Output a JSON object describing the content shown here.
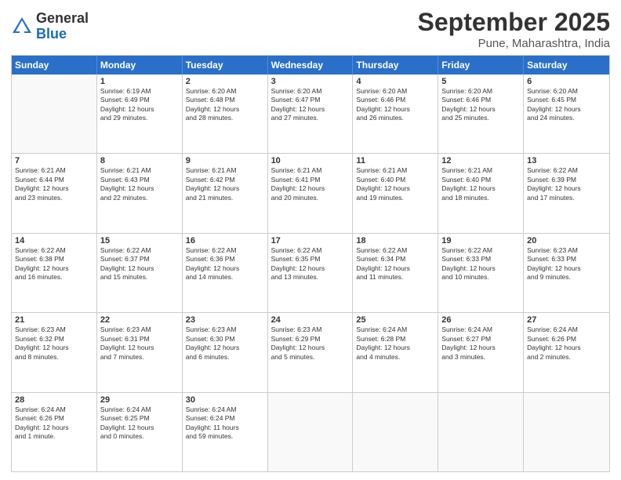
{
  "logo": {
    "general": "General",
    "blue": "Blue"
  },
  "title": "September 2025",
  "subtitle": "Pune, Maharashtra, India",
  "days": [
    "Sunday",
    "Monday",
    "Tuesday",
    "Wednesday",
    "Thursday",
    "Friday",
    "Saturday"
  ],
  "weeks": [
    [
      {
        "day": "",
        "info": ""
      },
      {
        "day": "1",
        "info": "Sunrise: 6:19 AM\nSunset: 6:49 PM\nDaylight: 12 hours\nand 29 minutes."
      },
      {
        "day": "2",
        "info": "Sunrise: 6:20 AM\nSunset: 6:48 PM\nDaylight: 12 hours\nand 28 minutes."
      },
      {
        "day": "3",
        "info": "Sunrise: 6:20 AM\nSunset: 6:47 PM\nDaylight: 12 hours\nand 27 minutes."
      },
      {
        "day": "4",
        "info": "Sunrise: 6:20 AM\nSunset: 6:46 PM\nDaylight: 12 hours\nand 26 minutes."
      },
      {
        "day": "5",
        "info": "Sunrise: 6:20 AM\nSunset: 6:46 PM\nDaylight: 12 hours\nand 25 minutes."
      },
      {
        "day": "6",
        "info": "Sunrise: 6:20 AM\nSunset: 6:45 PM\nDaylight: 12 hours\nand 24 minutes."
      }
    ],
    [
      {
        "day": "7",
        "info": "Sunrise: 6:21 AM\nSunset: 6:44 PM\nDaylight: 12 hours\nand 23 minutes."
      },
      {
        "day": "8",
        "info": "Sunrise: 6:21 AM\nSunset: 6:43 PM\nDaylight: 12 hours\nand 22 minutes."
      },
      {
        "day": "9",
        "info": "Sunrise: 6:21 AM\nSunset: 6:42 PM\nDaylight: 12 hours\nand 21 minutes."
      },
      {
        "day": "10",
        "info": "Sunrise: 6:21 AM\nSunset: 6:41 PM\nDaylight: 12 hours\nand 20 minutes."
      },
      {
        "day": "11",
        "info": "Sunrise: 6:21 AM\nSunset: 6:40 PM\nDaylight: 12 hours\nand 19 minutes."
      },
      {
        "day": "12",
        "info": "Sunrise: 6:21 AM\nSunset: 6:40 PM\nDaylight: 12 hours\nand 18 minutes."
      },
      {
        "day": "13",
        "info": "Sunrise: 6:22 AM\nSunset: 6:39 PM\nDaylight: 12 hours\nand 17 minutes."
      }
    ],
    [
      {
        "day": "14",
        "info": "Sunrise: 6:22 AM\nSunset: 6:38 PM\nDaylight: 12 hours\nand 16 minutes."
      },
      {
        "day": "15",
        "info": "Sunrise: 6:22 AM\nSunset: 6:37 PM\nDaylight: 12 hours\nand 15 minutes."
      },
      {
        "day": "16",
        "info": "Sunrise: 6:22 AM\nSunset: 6:36 PM\nDaylight: 12 hours\nand 14 minutes."
      },
      {
        "day": "17",
        "info": "Sunrise: 6:22 AM\nSunset: 6:35 PM\nDaylight: 12 hours\nand 13 minutes."
      },
      {
        "day": "18",
        "info": "Sunrise: 6:22 AM\nSunset: 6:34 PM\nDaylight: 12 hours\nand 11 minutes."
      },
      {
        "day": "19",
        "info": "Sunrise: 6:22 AM\nSunset: 6:33 PM\nDaylight: 12 hours\nand 10 minutes."
      },
      {
        "day": "20",
        "info": "Sunrise: 6:23 AM\nSunset: 6:33 PM\nDaylight: 12 hours\nand 9 minutes."
      }
    ],
    [
      {
        "day": "21",
        "info": "Sunrise: 6:23 AM\nSunset: 6:32 PM\nDaylight: 12 hours\nand 8 minutes."
      },
      {
        "day": "22",
        "info": "Sunrise: 6:23 AM\nSunset: 6:31 PM\nDaylight: 12 hours\nand 7 minutes."
      },
      {
        "day": "23",
        "info": "Sunrise: 6:23 AM\nSunset: 6:30 PM\nDaylight: 12 hours\nand 6 minutes."
      },
      {
        "day": "24",
        "info": "Sunrise: 6:23 AM\nSunset: 6:29 PM\nDaylight: 12 hours\nand 5 minutes."
      },
      {
        "day": "25",
        "info": "Sunrise: 6:24 AM\nSunset: 6:28 PM\nDaylight: 12 hours\nand 4 minutes."
      },
      {
        "day": "26",
        "info": "Sunrise: 6:24 AM\nSunset: 6:27 PM\nDaylight: 12 hours\nand 3 minutes."
      },
      {
        "day": "27",
        "info": "Sunrise: 6:24 AM\nSunset: 6:26 PM\nDaylight: 12 hours\nand 2 minutes."
      }
    ],
    [
      {
        "day": "28",
        "info": "Sunrise: 6:24 AM\nSunset: 6:26 PM\nDaylight: 12 hours\nand 1 minute."
      },
      {
        "day": "29",
        "info": "Sunrise: 6:24 AM\nSunset: 6:25 PM\nDaylight: 12 hours\nand 0 minutes."
      },
      {
        "day": "30",
        "info": "Sunrise: 6:24 AM\nSunset: 6:24 PM\nDaylight: 11 hours\nand 59 minutes."
      },
      {
        "day": "",
        "info": ""
      },
      {
        "day": "",
        "info": ""
      },
      {
        "day": "",
        "info": ""
      },
      {
        "day": "",
        "info": ""
      }
    ]
  ]
}
